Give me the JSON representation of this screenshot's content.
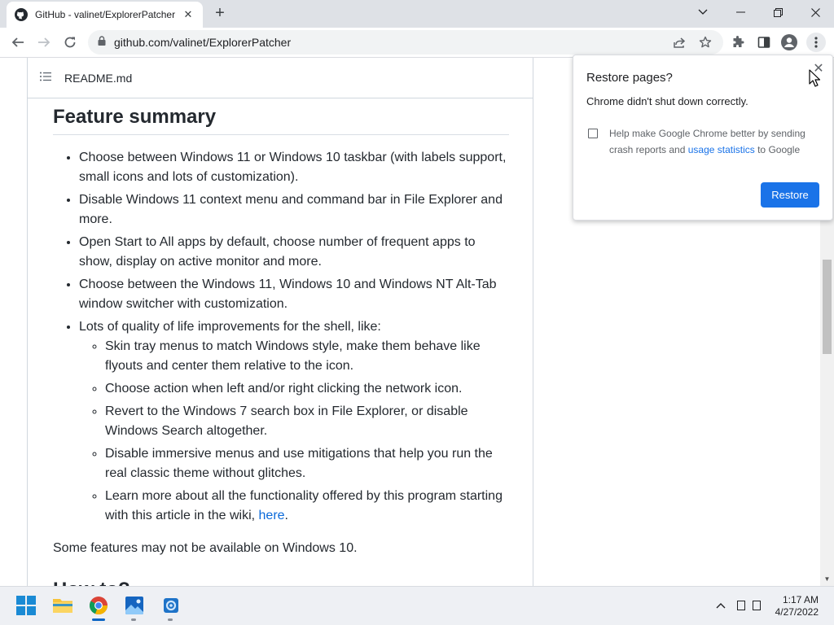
{
  "browser": {
    "tab_title": "GitHub - valinet/ExplorerPatcher",
    "url": "github.com/valinet/ExplorerPatcher"
  },
  "readme": {
    "filename": "README.md"
  },
  "content": {
    "heading": "Feature summary",
    "items": [
      "Choose between Windows 11 or Windows 10 taskbar (with labels support, small icons and lots of customization).",
      "Disable Windows 11 context menu and command bar in File Explorer and more.",
      "Open Start to All apps by default, choose number of frequent apps to show, display on active monitor and more.",
      "Choose between the Windows 11, Windows 10 and Windows NT Alt-Tab window switcher with customization.",
      "Lots of quality of life improvements for the shell, like:"
    ],
    "subitems": [
      "Skin tray menus to match Windows style, make them behave like flyouts and center them relative to the icon.",
      "Choose action when left and/or right clicking the network icon.",
      "Revert to the Windows 7 search box in File Explorer, or disable Windows Search altogether.",
      "Disable immersive menus and use mitigations that help you run the real classic theme without glitches."
    ],
    "last_subitem_text": "Learn more about all the functionality offered by this program starting with this article in the wiki, ",
    "last_subitem_link": "here",
    "last_subitem_end": ".",
    "note": "Some features may not be available on Windows 10.",
    "next_heading": "How to?"
  },
  "popup": {
    "title": "Restore pages?",
    "message": "Chrome didn't shut down correctly.",
    "checkbox_text": "Help make Google Chrome better by sending crash reports and ",
    "checkbox_link": "usage statistics",
    "checkbox_end": " to Google",
    "checkbox_checked": false,
    "restore_label": "Restore"
  },
  "taskbar": {
    "time": "1:17 AM",
    "date": "4/27/2022",
    "apps": [
      "start-icon",
      "file-explorer-icon",
      "chrome-icon",
      "photos-icon",
      "settings-icon"
    ]
  },
  "colors": {
    "accent": "#1a73e8",
    "link": "#0969da",
    "text": "#24292f"
  }
}
